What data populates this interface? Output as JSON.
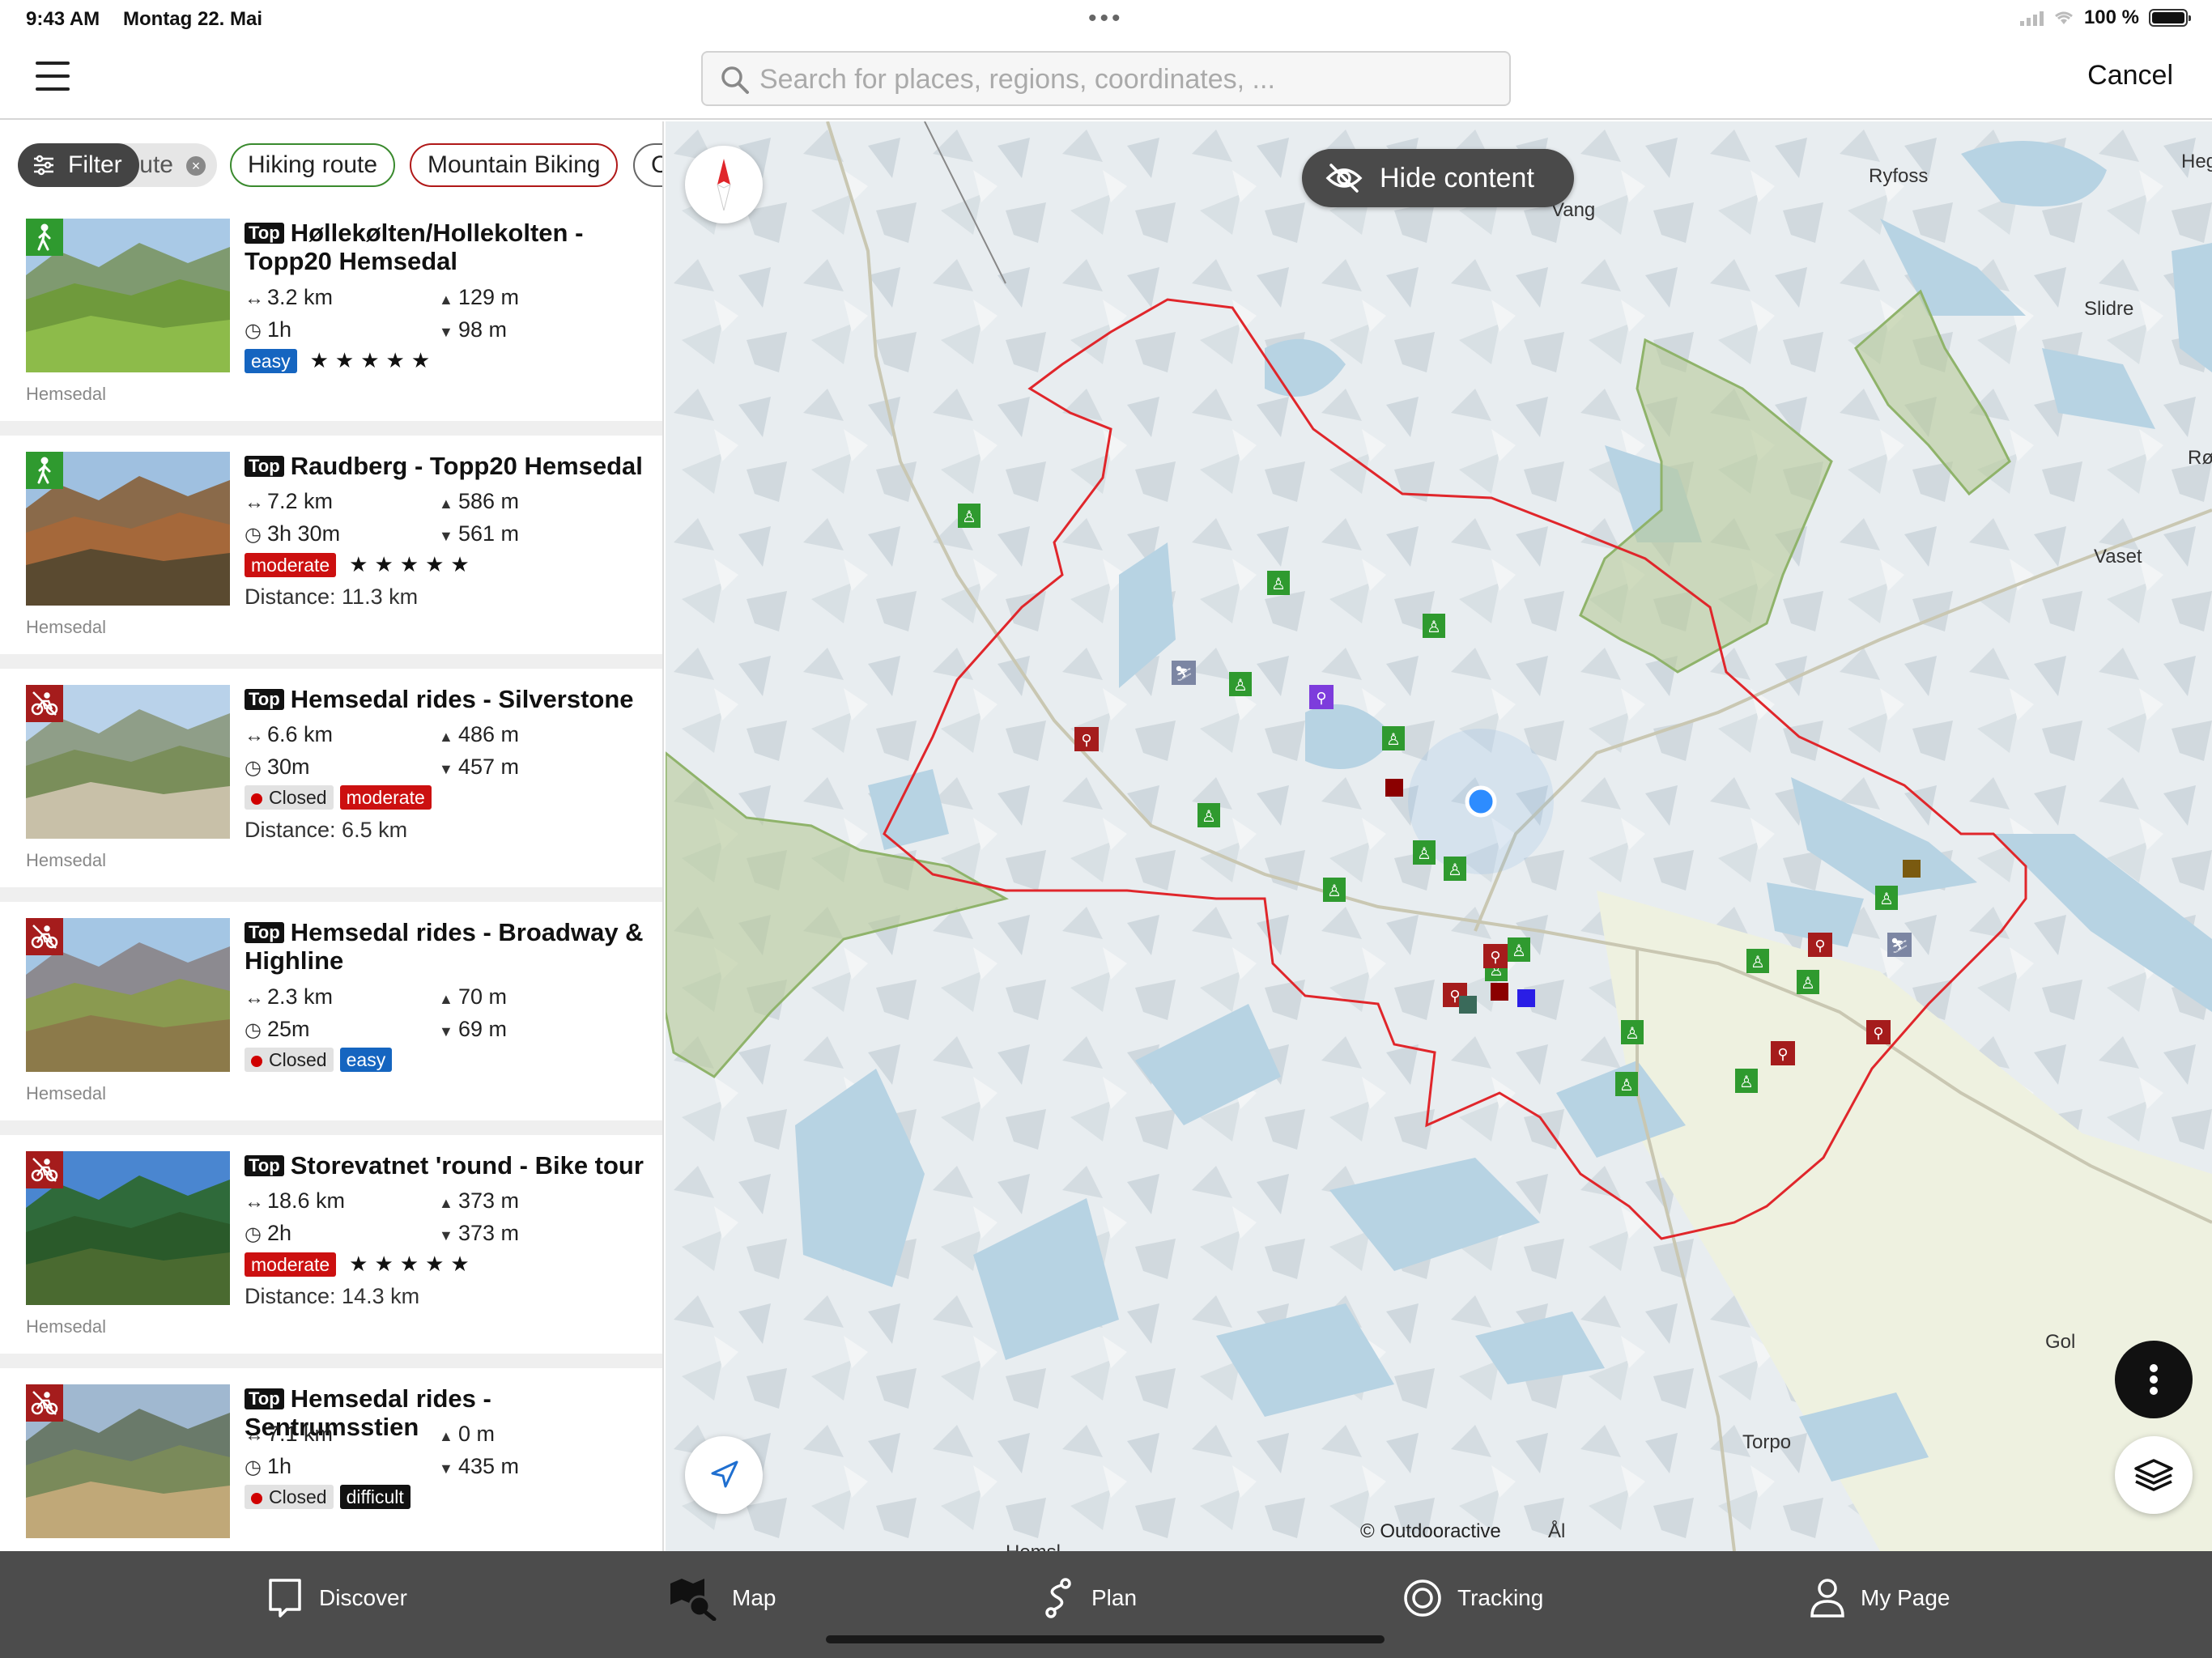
{
  "status_bar": {
    "time": "9:43 AM",
    "date": "Montag 22. Mai",
    "battery": "100 %"
  },
  "search": {
    "placeholder": "Search for places, regions, coordinates, ...",
    "value": "",
    "cancel_label": "Cancel"
  },
  "filters": {
    "filter_label": "Filter",
    "chips": [
      {
        "label": "ute"
      },
      {
        "label": "Hiking route"
      },
      {
        "label": "Mountain Biking"
      },
      {
        "label": "C"
      }
    ]
  },
  "results": [
    {
      "icon": "hiking-icon",
      "top_label": "Top",
      "title": "Høllekølten/Hollekolten - Topp20 Hemsedal",
      "length": "3.2 km",
      "duration": "1h",
      "ascent": "129 m",
      "descent": "98 m",
      "closed": "",
      "difficulty": "easy",
      "stars": "★★★★★",
      "distance": "",
      "region": "Hemsedal"
    },
    {
      "icon": "hiking-icon",
      "top_label": "Top",
      "title": "Raudberg - Topp20 Hemsedal",
      "length": "7.2 km",
      "duration": "3h 30m",
      "ascent": "586 m",
      "descent": "561 m",
      "closed": "",
      "difficulty": "moderate",
      "stars": "★★★★★",
      "distance": "Distance: 11.3 km",
      "region": "Hemsedal"
    },
    {
      "icon": "mountain-bike-icon",
      "top_label": "Top",
      "title": "Hemsedal rides - Silverstone",
      "length": "6.6 km",
      "duration": "30m",
      "ascent": "486 m",
      "descent": "457 m",
      "closed": "Closed",
      "difficulty": "moderate",
      "stars": "",
      "distance": "Distance: 6.5 km",
      "region": "Hemsedal"
    },
    {
      "icon": "mountain-bike-icon",
      "top_label": "Top",
      "title": "Hemsedal rides - Broadway & Highline",
      "length": "2.3 km",
      "duration": "25m",
      "ascent": "70 m",
      "descent": "69 m",
      "closed": "Closed",
      "difficulty": "easy",
      "stars": "",
      "distance": "",
      "region": "Hemsedal"
    },
    {
      "icon": "mountain-bike-icon",
      "top_label": "Top",
      "title": "Storevatnet 'round - Bike tour",
      "length": "18.6 km",
      "duration": "2h",
      "ascent": "373 m",
      "descent": "373 m",
      "closed": "",
      "difficulty": "moderate",
      "stars": "★★★★★",
      "distance": "Distance: 14.3 km",
      "region": "Hemsedal"
    },
    {
      "icon": "mountain-bike-icon",
      "top_label": "Top",
      "title": "Hemsedal rides - Sentrumsstien",
      "length": "7.1 km",
      "duration": "1h",
      "ascent": "0 m",
      "descent": "435 m",
      "closed": "Closed",
      "difficulty": "difficult",
      "stars": "",
      "distance": "",
      "region": "Hemsedal"
    }
  ],
  "map": {
    "hide_content_label": "Hide content",
    "attribution": "© Outdooractive",
    "places": [
      "Ryfoss",
      "Vang",
      "Slidre",
      "Vaset",
      "Gol",
      "Torpo",
      "Heg",
      "Røn",
      "Ål",
      "Hemsl"
    ]
  },
  "tabs": [
    {
      "label": "Discover",
      "icon": "discover-icon"
    },
    {
      "label": "Map",
      "icon": "map-icon"
    },
    {
      "label": "Plan",
      "icon": "plan-icon"
    },
    {
      "label": "Tracking",
      "icon": "tracking-icon"
    },
    {
      "label": "My Page",
      "icon": "user-icon"
    }
  ],
  "colors": {
    "hiking": "#2f9a2f",
    "biking": "#a51c1c",
    "easy": "#1565c0",
    "moderate": "#cc1010",
    "difficult": "#111111",
    "region_border": "#e0262b",
    "water": "#b7d3e3"
  }
}
